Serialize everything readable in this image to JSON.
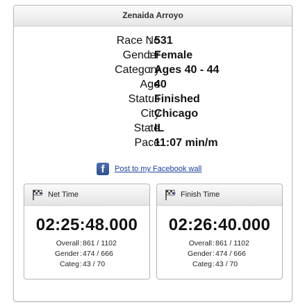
{
  "header": {
    "name": "Zenaida Arroyo"
  },
  "info": [
    {
      "label": "Race No",
      "value": "531"
    },
    {
      "label": "Gender",
      "value": "Female"
    },
    {
      "label": "Category",
      "value": "Ages 40 - 44"
    },
    {
      "label": "Age",
      "value": "40"
    },
    {
      "label": "Status",
      "value": "Finished"
    },
    {
      "label": "City",
      "value": "Chicago"
    },
    {
      "label": "State",
      "value": "IL"
    },
    {
      "label": "Pace",
      "value": "11:07 min/m"
    }
  ],
  "separator": ":",
  "facebook": {
    "icon": "facebook-icon",
    "icon_glyph": "f",
    "link_text": "Post to my Facebook wall"
  },
  "net_time": {
    "title": "Net Time",
    "icon": "checkered-flag-icon",
    "value": "02:25:48.000",
    "ranks": [
      {
        "label": "Overall",
        "value": "861 / 1102"
      },
      {
        "label": "Gender",
        "value": "474 / 666"
      },
      {
        "label": "Categ",
        "value": "43 / 70"
      }
    ]
  },
  "finish_time": {
    "title": "Finish Time",
    "icon": "checkered-flag-icon",
    "value": "02:26:40.000",
    "ranks": [
      {
        "label": "Overall",
        "value": "861 / 1102"
      },
      {
        "label": "Gender",
        "value": "474 / 666"
      },
      {
        "label": "Categ",
        "value": "43 / 70"
      }
    ]
  },
  "colors": {
    "link": "#1a3fa0",
    "facebook_blue": "#3b5998",
    "border": "#b9b9b9"
  }
}
